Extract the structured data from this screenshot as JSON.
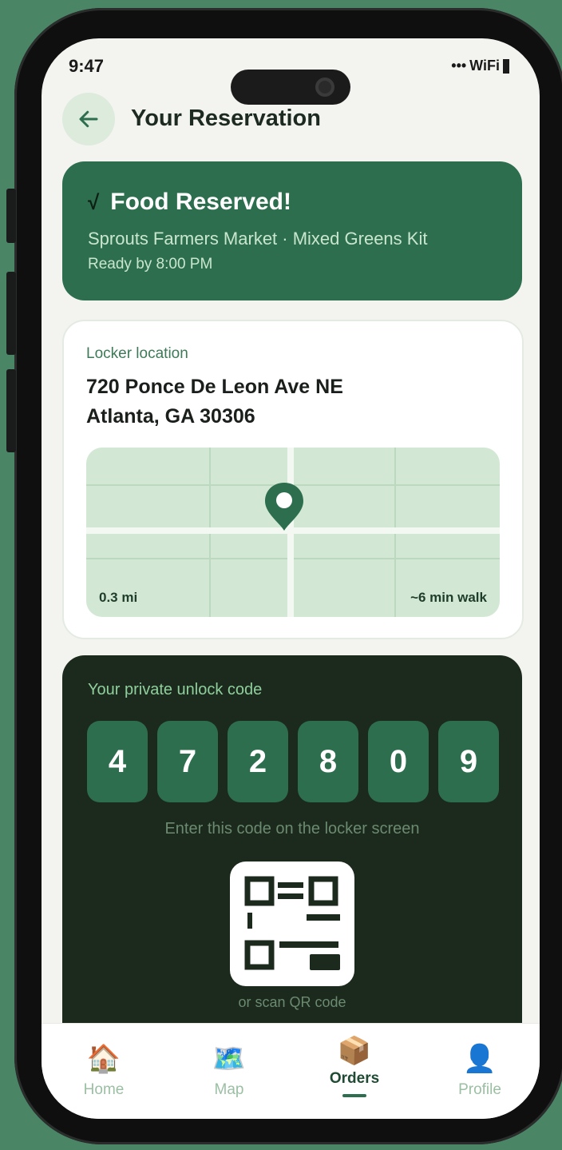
{
  "status": {
    "time": "9:47",
    "signal": "•••",
    "wifi": "WiFi"
  },
  "header": {
    "title": "Your Reservation"
  },
  "reservation": {
    "title": "Food Reserved!",
    "check": "√",
    "details": "Sprouts Farmers Market · Mixed Greens Kit",
    "ready": "Ready by 8:00 PM"
  },
  "locker": {
    "label": "Locker location",
    "address_line1": "720 Ponce De Leon Ave NE",
    "address_line2": "Atlanta, GA 30306",
    "distance": "0.3 mi",
    "walk": "~6 min walk"
  },
  "unlock": {
    "label": "Your private unlock code",
    "digits": [
      "4",
      "7",
      "2",
      "8",
      "0",
      "9"
    ],
    "hint": "Enter this code on the locker screen",
    "qr_caption": "or scan QR code"
  },
  "tabs": [
    {
      "label": "Home",
      "icon": "🏠",
      "icon_name": "house-icon"
    },
    {
      "label": "Map",
      "icon": "🗺️",
      "icon_name": "map-icon"
    },
    {
      "label": "Orders",
      "icon": "📦",
      "icon_name": "package-icon",
      "active": true
    },
    {
      "label": "Profile",
      "icon": "👤",
      "icon_name": "profile-icon"
    }
  ],
  "colors": {
    "background": "#4a8566",
    "primary": "#2d6e4e",
    "dark_card": "#1b2a1d",
    "accent_text": "#8fcf9c"
  }
}
